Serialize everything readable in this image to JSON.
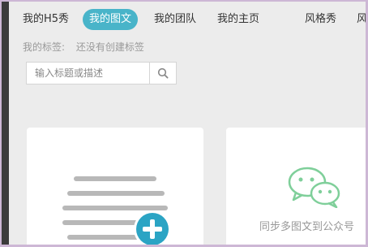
{
  "nav": {
    "items": [
      {
        "label": "我的H5秀",
        "active": false
      },
      {
        "label": "我的图文",
        "active": true
      },
      {
        "label": "我的团队",
        "active": false
      },
      {
        "label": "我的主页",
        "active": false
      },
      {
        "label": "风格秀",
        "active": false
      },
      {
        "label": "风",
        "active": false
      }
    ]
  },
  "tags": {
    "label": "我的标签:",
    "empty_text": "还没有创建标签"
  },
  "search": {
    "placeholder": "输入标题或描述",
    "icon": "search-icon"
  },
  "cards": {
    "create": {
      "icon": "add-icon"
    },
    "sync": {
      "icon": "wechat-icon",
      "text": "同步多图文到公众号"
    }
  },
  "colors": {
    "accent": "#49b4c9",
    "plus": "#2ba4c4",
    "wechat": "#7fcf9a"
  }
}
